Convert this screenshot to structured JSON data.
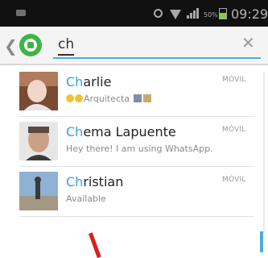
{
  "status_bar": {
    "battery_text": "50%",
    "battery_level": 0.5,
    "time": "09:29",
    "icons": [
      "notification-icon",
      "alarm-icon",
      "wifi-icon",
      "signal-icon",
      "battery-icon"
    ]
  },
  "search": {
    "value": "ch",
    "back_icon": "chevron-left-icon",
    "logo_icon": "whatsapp-logo-icon",
    "clear_icon": "close-icon"
  },
  "contacts": [
    {
      "name_match": "Ch",
      "name_rest": "arlie",
      "label": "MÓVIL",
      "status_text": "Arquitecta"
    },
    {
      "name_match": "Ch",
      "name_rest": "ema Lapuente",
      "label": "MÓVIL",
      "status_text": "Hey there! I am using WhatsApp."
    },
    {
      "name_match": "Ch",
      "name_rest": "ristian",
      "label": "MÓVIL",
      "status_text": "Available"
    }
  ],
  "colors": {
    "accent": "#37a3d9",
    "whatsapp_green": "#3fb449",
    "status_bar": "#111111"
  }
}
